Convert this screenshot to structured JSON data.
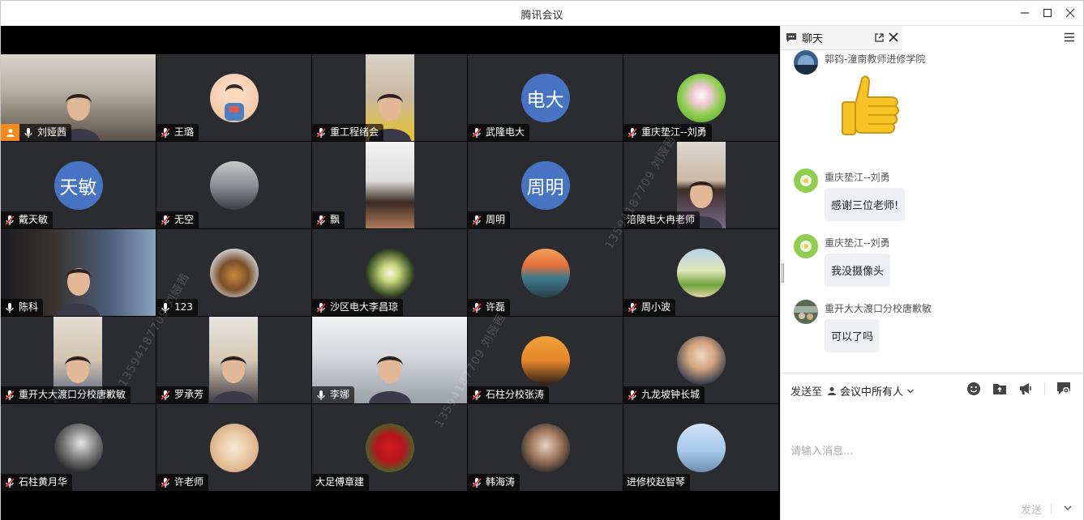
{
  "window": {
    "title": "腾讯会议"
  },
  "sidebar": {
    "tab_label": "聊天",
    "messages": [
      {
        "sender": "郭钧-潼南教师进修学院",
        "content": "👍",
        "type": "emoji"
      },
      {
        "sender": "重庆垫江--刘勇",
        "content": "感谢三位老师!",
        "type": "text"
      },
      {
        "sender": "重庆垫江--刘勇",
        "content": "我没摄像头",
        "type": "text"
      },
      {
        "sender": "重开大大渡口分校唐歉敏",
        "content": "可以了吗",
        "type": "text"
      }
    ],
    "compose": {
      "send_to_label": "发送至",
      "send_to_target": "会议中所有人",
      "placeholder": "请输入消息...",
      "send_label": "发送"
    }
  },
  "participants": [
    {
      "name": "刘娅茜",
      "mic": "on",
      "host": true,
      "view": "video"
    },
    {
      "name": "王璐",
      "mic": "muted",
      "view": "avatar"
    },
    {
      "name": "重工程绪会",
      "mic": "muted",
      "view": "video"
    },
    {
      "name": "武隆电大",
      "mic": "muted",
      "view": "text",
      "avatar_text": "电大"
    },
    {
      "name": "重庆垫江--刘勇",
      "mic": "muted",
      "view": "avatar"
    },
    {
      "name": "戴天敏",
      "mic": "muted",
      "view": "text",
      "avatar_text": "天敏"
    },
    {
      "name": "无空",
      "mic": "muted",
      "view": "avatar"
    },
    {
      "name": "飘",
      "mic": "muted",
      "view": "video"
    },
    {
      "name": "周明",
      "mic": "muted",
      "view": "text",
      "avatar_text": "周明"
    },
    {
      "name": "涪陵电大冉老师",
      "mic": "none",
      "view": "video"
    },
    {
      "name": "陈科",
      "mic": "on",
      "view": "video"
    },
    {
      "name": "123",
      "mic": "on",
      "view": "avatar"
    },
    {
      "name": "沙区电大李昌琼",
      "mic": "muted",
      "view": "avatar"
    },
    {
      "name": "许磊",
      "mic": "muted",
      "view": "avatar"
    },
    {
      "name": "周小波",
      "mic": "muted",
      "view": "avatar"
    },
    {
      "name": "重开大大渡口分校唐歉敏",
      "mic": "muted",
      "view": "video"
    },
    {
      "name": "罗承芳",
      "mic": "muted",
      "view": "video"
    },
    {
      "name": "李娜",
      "mic": "on",
      "view": "video"
    },
    {
      "name": "石柱分校张涛",
      "mic": "muted",
      "view": "avatar"
    },
    {
      "name": "九龙坡钟长城",
      "mic": "muted",
      "view": "avatar"
    },
    {
      "name": "石柱黄月华",
      "mic": "muted",
      "view": "avatar"
    },
    {
      "name": "许老师",
      "mic": "muted",
      "view": "avatar"
    },
    {
      "name": "大足傅章建",
      "mic": "none",
      "view": "avatar"
    },
    {
      "name": "韩海涛",
      "mic": "muted",
      "view": "avatar"
    },
    {
      "name": "进修校赵智琴",
      "mic": "none",
      "view": "avatar"
    }
  ],
  "watermark": "13594187709 刘娅茜",
  "colors": {
    "tile_bg": "#2b2c30",
    "avatar_text_bg": "#4674c3",
    "host_badge": "#f28b1c"
  }
}
